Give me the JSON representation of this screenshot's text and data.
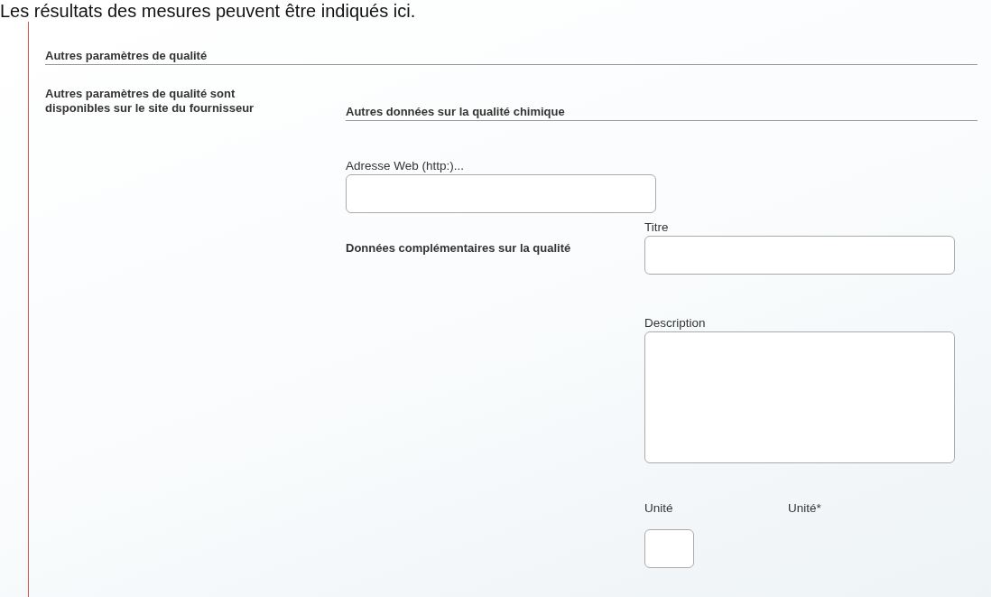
{
  "intro": "Les résultats des mesures peuvent être indiqués ici.",
  "section": {
    "title": "Autres paramètres de qualité",
    "note": "Autres paramètres de qualité sont disponibles sur le site du fournisseur",
    "subsection": {
      "title": "Autres données sur la qualité chimique",
      "web_field": {
        "label": "Adresse Web (http:)..."
      },
      "complement": {
        "label": "Données complémentaires sur la qualité",
        "title_field": {
          "label": "Titre"
        },
        "description_field": {
          "label": "Description"
        },
        "unit_labels": [
          "Unité",
          "Unité*"
        ]
      }
    }
  }
}
